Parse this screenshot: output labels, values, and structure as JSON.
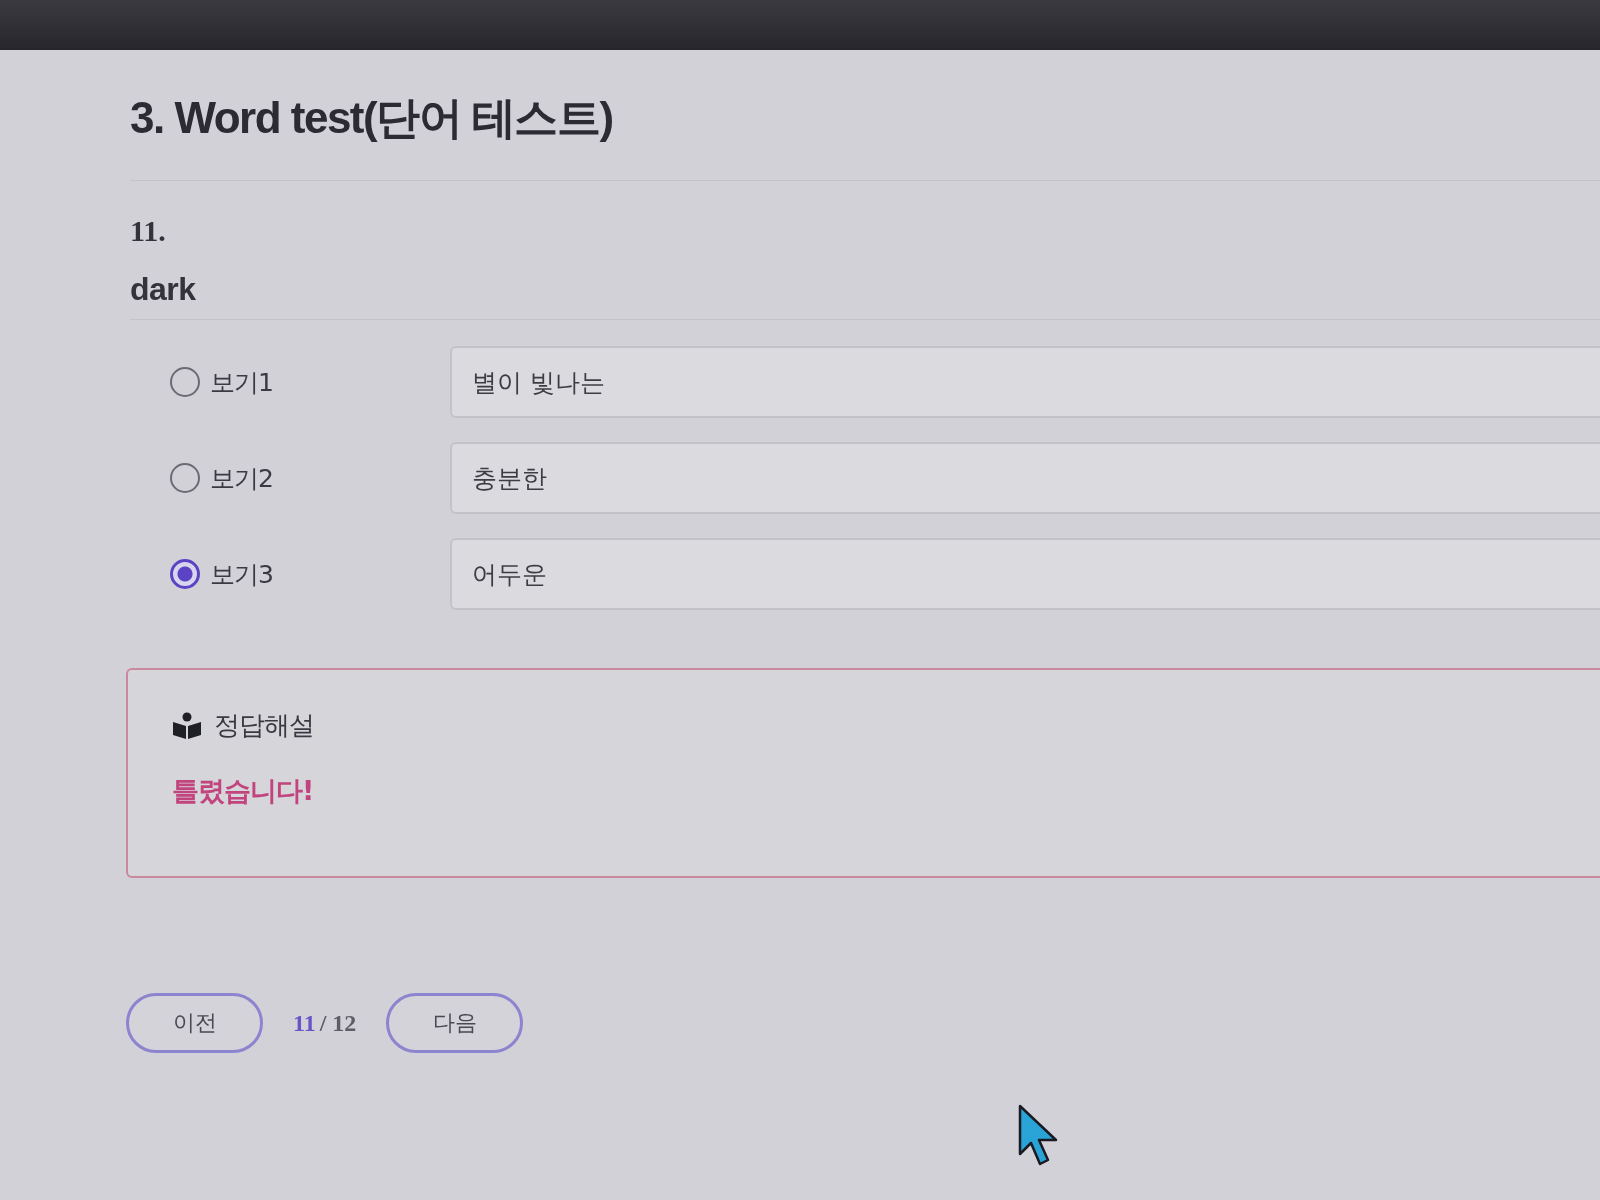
{
  "title": "3. Word test(단어 테스트)",
  "question": {
    "number": "11.",
    "word": "dark"
  },
  "options": [
    {
      "label": "보기1",
      "text": "별이 빛나는",
      "selected": false
    },
    {
      "label": "보기2",
      "text": "충분한",
      "selected": false
    },
    {
      "label": "보기3",
      "text": "어두운",
      "selected": true
    }
  ],
  "explanation": {
    "heading": "정답해설",
    "result": "틀렸습니다!",
    "correct": false
  },
  "pagination": {
    "prev": "이전",
    "current": "11",
    "total": "/ 12",
    "next": "다음"
  }
}
